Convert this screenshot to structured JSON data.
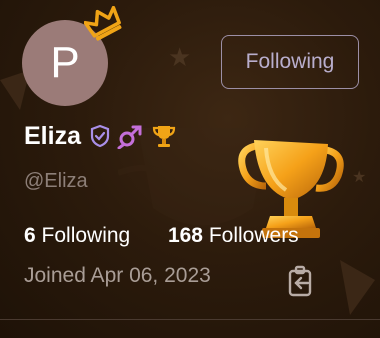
{
  "profile": {
    "avatar_letter": "P",
    "name": "Eliza",
    "handle": "@Eliza",
    "follow_button_label": "Following",
    "following_count": "6",
    "following_label": "Following",
    "followers_count": "168",
    "followers_label": "Followers",
    "joined_text": "Joined Apr 06, 2023"
  },
  "icons": {
    "avatar_decoration": "crown-icon",
    "badges": [
      "shield-check-icon",
      "gender-icon",
      "trophy-icon"
    ],
    "highlight": "trophy-icon",
    "copy": "clipboard-icon"
  },
  "colors": {
    "background": "#2c1b0c",
    "accent_gold": "#f0a416",
    "accent_purple": "#a98fe8",
    "button_border": "#9c8fa6",
    "avatar": "#9b7b78"
  }
}
